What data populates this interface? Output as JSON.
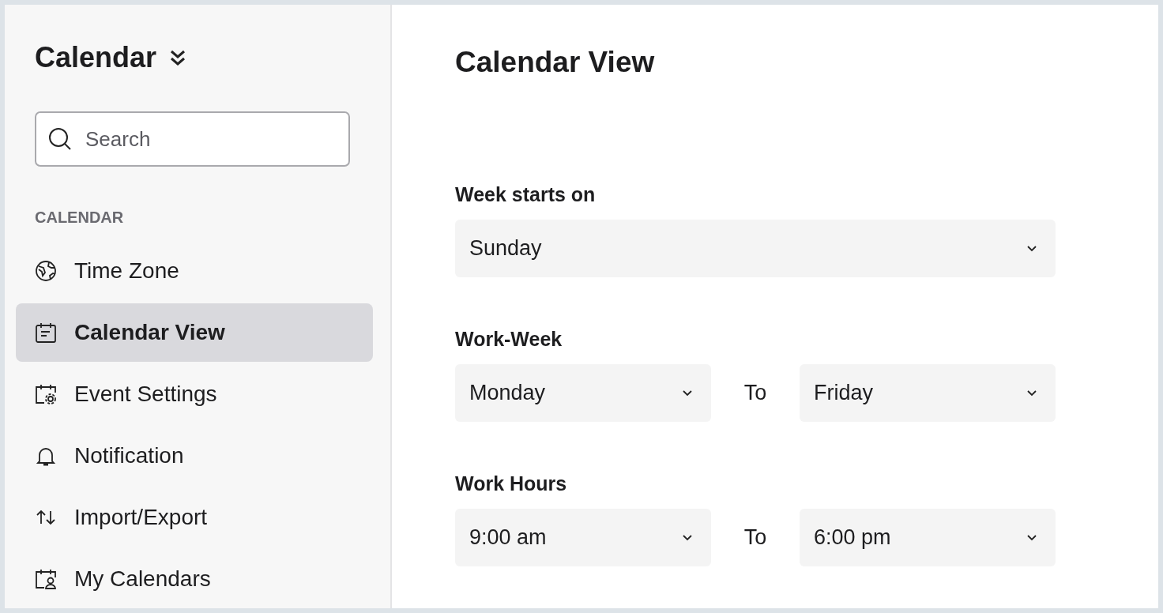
{
  "sidebar": {
    "title": "Calendar",
    "search": {
      "placeholder": "Search"
    },
    "section": "CALENDAR",
    "items": [
      {
        "label": "Time Zone",
        "selected": false
      },
      {
        "label": "Calendar View",
        "selected": true
      },
      {
        "label": "Event Settings",
        "selected": false
      },
      {
        "label": "Notification",
        "selected": false
      },
      {
        "label": "Import/Export",
        "selected": false
      },
      {
        "label": "My Calendars",
        "selected": false
      }
    ]
  },
  "main": {
    "title": "Calendar View",
    "week_start": {
      "label": "Week starts on",
      "value": "Sunday"
    },
    "work_week": {
      "label": "Work-Week",
      "from": "Monday",
      "separator": "To",
      "to": "Friday"
    },
    "work_hours": {
      "label": "Work Hours",
      "from": "9:00 am",
      "separator": "To",
      "to": "6:00 pm"
    }
  }
}
